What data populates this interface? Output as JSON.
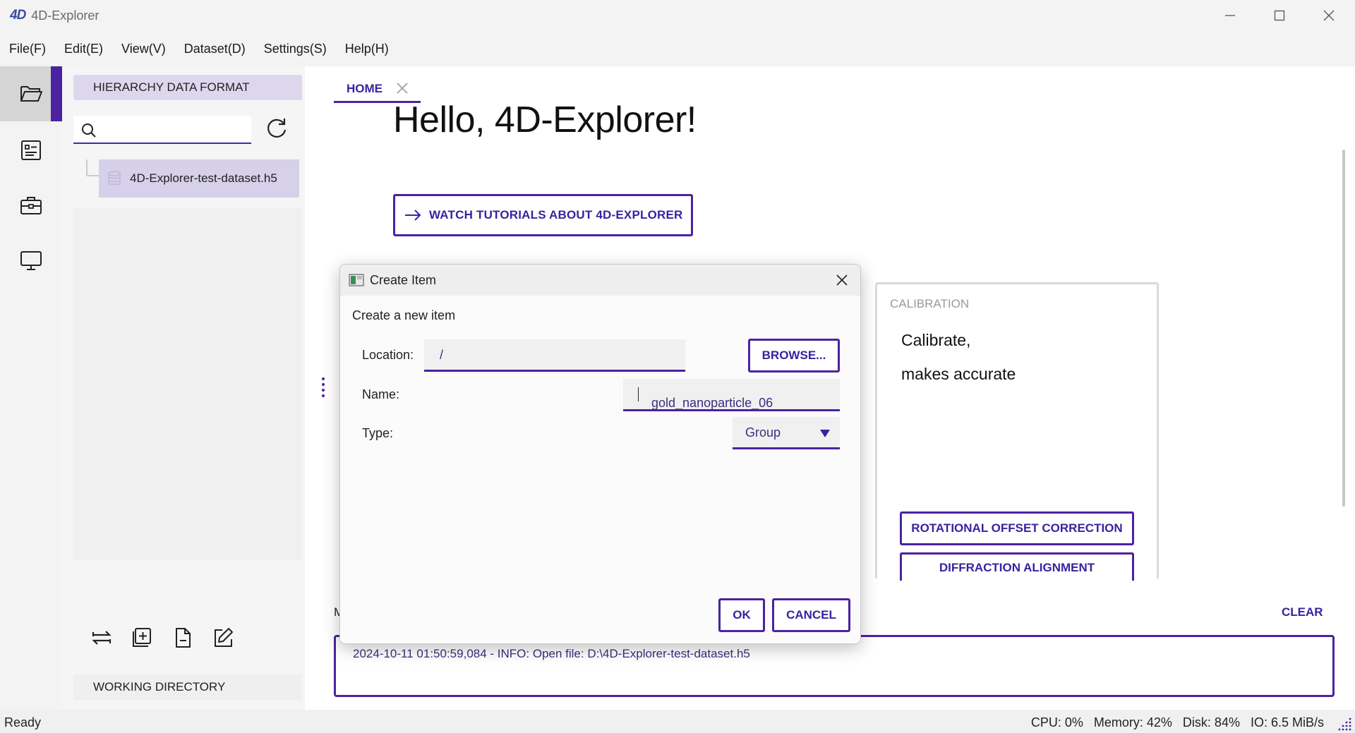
{
  "window": {
    "title": "4D-Explorer",
    "logo_text": "4D",
    "minimize_icon": "minimize-icon",
    "maximize_icon": "maximize-icon",
    "close_icon": "close-icon"
  },
  "menu": [
    "File(F)",
    "Edit(E)",
    "View(V)",
    "Dataset(D)",
    "Settings(S)",
    "Help(H)"
  ],
  "rail": {
    "items": [
      {
        "icon": "folder-open-icon",
        "active": true
      },
      {
        "icon": "document-list-icon",
        "active": false
      },
      {
        "icon": "toolbox-icon",
        "active": false
      },
      {
        "icon": "monitor-icon",
        "active": false
      }
    ],
    "settings_icon": "gear-icon"
  },
  "sidebar": {
    "header": "HIERARCHY DATA FORMAT",
    "search_placeholder": "",
    "tree": [
      {
        "label": "4D-Explorer-test-dataset.h5",
        "icon": "database-icon"
      }
    ],
    "tools": [
      "swap-icon",
      "add-item-icon",
      "new-file-icon",
      "edit-icon"
    ],
    "working_directory": "WORKING DIRECTORY"
  },
  "main": {
    "tab_label": "HOME",
    "heading": "Hello, 4D-Explorer!",
    "watch_button": "WATCH TUTORIALS ABOUT 4D-EXPLORER",
    "calibration": {
      "header": "CALIBRATION",
      "line1": "Calibrate,",
      "line2": "makes accurate",
      "rotational_button": "ROTATIONAL OFFSET CORRECTION",
      "diffraction_button": "DIFFRACTION ALIGNMENT"
    },
    "log_label": "M",
    "clear_button": "CLEAR",
    "log_line": "2024-10-11 01:50:59,084 - INFO: Open file: D:\\4D-Explorer-test-dataset.h5"
  },
  "status": {
    "left": "Ready",
    "right": "CPU: 0%   Memory: 42%   Disk: 84%   IO: 6.5 MiB/s"
  },
  "dialog": {
    "title": "Create Item",
    "subtitle": "Create a new item",
    "location_label": "Location:",
    "location_value": "/",
    "browse_button": "BROWSE...",
    "name_label": "Name:",
    "name_value": "gold_nanoparticle_06",
    "type_label": "Type:",
    "type_value": "Group",
    "ok_button": "OK",
    "cancel_button": "CANCEL"
  },
  "colors": {
    "accent": "#4b23a0",
    "accent_text": "#3b21a0",
    "selection": "#d6d0ea"
  }
}
